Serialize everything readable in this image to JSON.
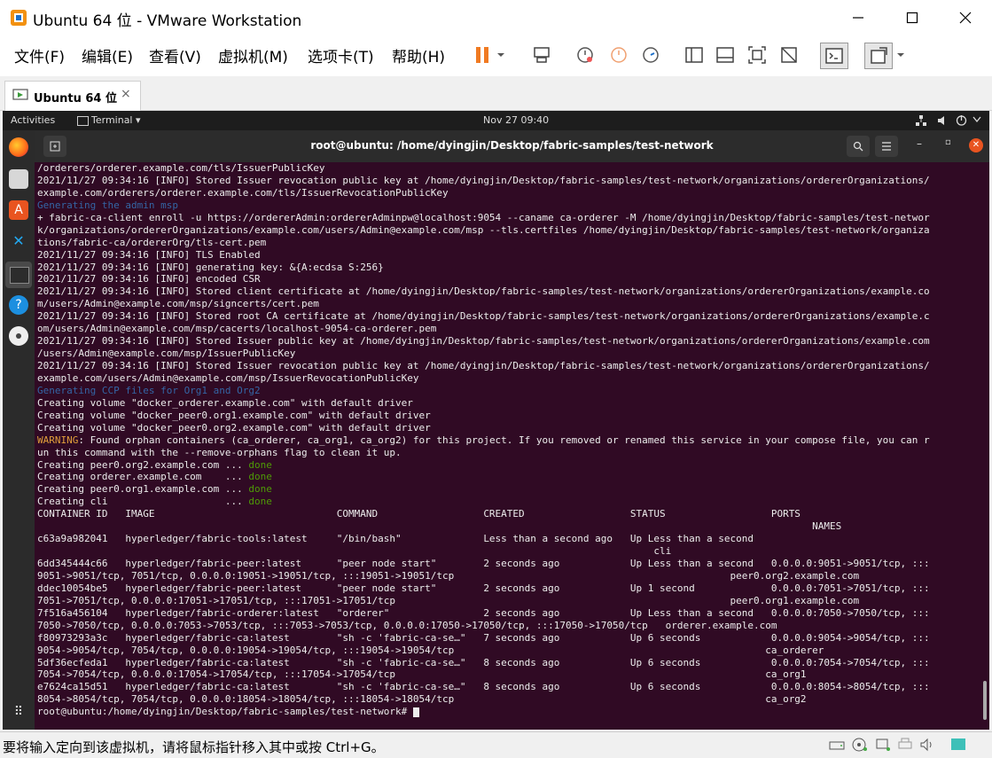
{
  "window": {
    "title": "Ubuntu 64 位 - VMware Workstation",
    "min_icon": "minimize-icon",
    "max_icon": "maximize-icon",
    "close_icon": "close-icon"
  },
  "menu": [
    "文件(F)",
    "编辑(E)",
    "查看(V)",
    "虚拟机(M)",
    "选项卡(T)",
    "帮助(H)"
  ],
  "tab": {
    "label": "Ubuntu 64 位",
    "close": "×"
  },
  "guest_topbar": {
    "activities": "Activities",
    "app": "Terminal ▾",
    "clock": "Nov 27  09:40"
  },
  "terminal": {
    "title": "root@ubuntu: /home/dyingjin/Desktop/fabric-samples/test-network",
    "lines": [
      [
        {
          "t": "/orderers/orderer.example.com/tls/IssuerPublicKey"
        }
      ],
      [
        {
          "t": "2021/11/27 09:34:16 [INFO] Stored Issuer revocation public key at /home/dyingjin/Desktop/fabric-samples/test-network/organizations/ordererOrganizations/"
        }
      ],
      [
        {
          "t": "example.com/orderers/orderer.example.com/tls/IssuerRevocationPublicKey"
        }
      ],
      [
        {
          "t": "Generating the admin msp",
          "c": "blue"
        }
      ],
      [
        {
          "t": "+ fabric-ca-client enroll -u https://ordererAdmin:ordererAdminpw@localhost:9054 --caname ca-orderer -M /home/dyingjin/Desktop/fabric-samples/test-networ"
        }
      ],
      [
        {
          "t": "k/organizations/ordererOrganizations/example.com/users/Admin@example.com/msp --tls.certfiles /home/dyingjin/Desktop/fabric-samples/test-network/organiza"
        }
      ],
      [
        {
          "t": "tions/fabric-ca/ordererOrg/tls-cert.pem"
        }
      ],
      [
        {
          "t": "2021/11/27 09:34:16 [INFO] TLS Enabled"
        }
      ],
      [
        {
          "t": "2021/11/27 09:34:16 [INFO] generating key: &{A:ecdsa S:256}"
        }
      ],
      [
        {
          "t": "2021/11/27 09:34:16 [INFO] encoded CSR"
        }
      ],
      [
        {
          "t": "2021/11/27 09:34:16 [INFO] Stored client certificate at /home/dyingjin/Desktop/fabric-samples/test-network/organizations/ordererOrganizations/example.co"
        }
      ],
      [
        {
          "t": "m/users/Admin@example.com/msp/signcerts/cert.pem"
        }
      ],
      [
        {
          "t": "2021/11/27 09:34:16 [INFO] Stored root CA certificate at /home/dyingjin/Desktop/fabric-samples/test-network/organizations/ordererOrganizations/example.c"
        }
      ],
      [
        {
          "t": "om/users/Admin@example.com/msp/cacerts/localhost-9054-ca-orderer.pem"
        }
      ],
      [
        {
          "t": "2021/11/27 09:34:16 [INFO] Stored Issuer public key at /home/dyingjin/Desktop/fabric-samples/test-network/organizations/ordererOrganizations/example.com"
        }
      ],
      [
        {
          "t": "/users/Admin@example.com/msp/IssuerPublicKey"
        }
      ],
      [
        {
          "t": "2021/11/27 09:34:16 [INFO] Stored Issuer revocation public key at /home/dyingjin/Desktop/fabric-samples/test-network/organizations/ordererOrganizations/"
        }
      ],
      [
        {
          "t": "example.com/users/Admin@example.com/msp/IssuerRevocationPublicKey"
        }
      ],
      [
        {
          "t": "Generating CCP files for Org1 and Org2",
          "c": "blue"
        }
      ],
      [
        {
          "t": "Creating volume \"docker_orderer.example.com\" with default driver"
        }
      ],
      [
        {
          "t": "Creating volume \"docker_peer0.org1.example.com\" with default driver"
        }
      ],
      [
        {
          "t": "Creating volume \"docker_peer0.org2.example.com\" with default driver"
        }
      ],
      [
        {
          "t": "WARNING",
          "c": "warn"
        },
        {
          "t": ": Found orphan containers (ca_orderer, ca_org1, ca_org2) for this project. If you removed or renamed this service in your compose file, you can r"
        }
      ],
      [
        {
          "t": "un this command with the --remove-orphans flag to clean it up."
        }
      ],
      [
        {
          "t": "Creating peer0.org2.example.com ... "
        },
        {
          "t": "done",
          "c": "done"
        }
      ],
      [
        {
          "t": "Creating orderer.example.com    ... "
        },
        {
          "t": "done",
          "c": "done"
        }
      ],
      [
        {
          "t": "Creating peer0.org1.example.com ... "
        },
        {
          "t": "done",
          "c": "done"
        }
      ],
      [
        {
          "t": "Creating cli                    ... "
        },
        {
          "t": "done",
          "c": "done"
        }
      ],
      [
        {
          "t": "CONTAINER ID   IMAGE                               COMMAND                  CREATED                  STATUS                  PORTS"
        }
      ],
      [
        {
          "t": "                                                                                                                                    NAMES"
        }
      ],
      [
        {
          "t": "c63a9a982041   hyperledger/fabric-tools:latest     \"/bin/bash\"              Less than a second ago   Up Less than a second"
        }
      ],
      [
        {
          "t": "                                                                                                         cli"
        }
      ],
      [
        {
          "t": "6dd345444c66   hyperledger/fabric-peer:latest      \"peer node start\"        2 seconds ago            Up Less than a second   0.0.0.0:9051->9051/tcp, :::"
        }
      ],
      [
        {
          "t": "9051->9051/tcp, 7051/tcp, 0.0.0.0:19051->19051/tcp, :::19051->19051/tcp                                               peer0.org2.example.com"
        }
      ],
      [
        {
          "t": "ddec10054be5   hyperledger/fabric-peer:latest      \"peer node start\"        2 seconds ago            Up 1 second             0.0.0.0:7051->7051/tcp, :::"
        }
      ],
      [
        {
          "t": "7051->7051/tcp, 0.0.0.0:17051->17051/tcp, :::17051->17051/tcp                                                         peer0.org1.example.com"
        }
      ],
      [
        {
          "t": "7f516a456104   hyperledger/fabric-orderer:latest   \"orderer\"                2 seconds ago            Up Less than a second   0.0.0.0:7050->7050/tcp, :::"
        }
      ],
      [
        {
          "t": "7050->7050/tcp, 0.0.0.0:7053->7053/tcp, :::7053->7053/tcp, 0.0.0.0:17050->17050/tcp, :::17050->17050/tcp   orderer.example.com"
        }
      ],
      [
        {
          "t": "f80973293a3c   hyperledger/fabric-ca:latest        \"sh -c 'fabric-ca-se…\"   7 seconds ago            Up 6 seconds            0.0.0.0:9054->9054/tcp, :::"
        }
      ],
      [
        {
          "t": "9054->9054/tcp, 7054/tcp, 0.0.0.0:19054->19054/tcp, :::19054->19054/tcp                                                     ca_orderer"
        }
      ],
      [
        {
          "t": "5df36ecfeda1   hyperledger/fabric-ca:latest        \"sh -c 'fabric-ca-se…\"   8 seconds ago            Up 6 seconds            0.0.0.0:7054->7054/tcp, :::"
        }
      ],
      [
        {
          "t": "7054->7054/tcp, 0.0.0.0:17054->17054/tcp, :::17054->17054/tcp                                                               ca_org1"
        }
      ],
      [
        {
          "t": "e7624ca15d51   hyperledger/fabric-ca:latest        \"sh -c 'fabric-ca-se…\"   8 seconds ago            Up 6 seconds            0.0.0.0:8054->8054/tcp, :::"
        }
      ],
      [
        {
          "t": "8054->8054/tcp, 7054/tcp, 0.0.0.0:18054->18054/tcp, :::18054->18054/tcp                                                     ca_org2"
        }
      ],
      [
        {
          "t": "root@ubuntu:/home/dyingjin/Desktop/fabric-samples/test-network# "
        }
      ]
    ]
  },
  "colors": {
    "terminal_bg": "#300a24",
    "blue": "#3465a4",
    "warn": "#e09e3b",
    "done": "#4e9a06"
  },
  "status": {
    "message": "要将输入定向到该虚拟机，请将鼠标指针移入其中或按 Ctrl+G。"
  }
}
